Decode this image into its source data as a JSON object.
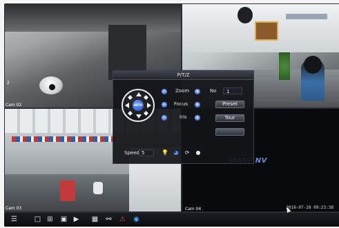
{
  "cameras": [
    {
      "label": "Cam 02"
    },
    {
      "label": ""
    },
    {
      "label": "Cam 03"
    },
    {
      "label": "Cam 04",
      "brand_text": "MART NV"
    }
  ],
  "camera_overlay_number": "2",
  "ptz": {
    "title": "P/T/Z",
    "dpad_center": "AUTO",
    "rows": [
      {
        "label": "Zoom",
        "minus": "−",
        "plus": "+"
      },
      {
        "label": "Focus",
        "minus": "−",
        "plus": "+"
      },
      {
        "label": "Iris",
        "minus": "−",
        "plus": "+"
      }
    ],
    "no_label": "No",
    "no_value": "1",
    "buttons": {
      "preset": "Preset",
      "tour": "Tour",
      "third": ""
    },
    "speed_label": "Speed",
    "speed_value": "5",
    "bottom_icons": [
      "light-bulb-icon",
      "wiper-icon",
      "refresh-icon",
      "aux-dot-icon"
    ]
  },
  "timestamp_cam4": "2016-07-28 09:23:38",
  "toolbar": {
    "icons": [
      "menu-icon",
      "single-view-icon",
      "quad-view-icon",
      "folder-icon",
      "playback-icon",
      "trash-icon",
      "zoom-icon",
      "alarm-icon",
      "globe-icon"
    ]
  }
}
